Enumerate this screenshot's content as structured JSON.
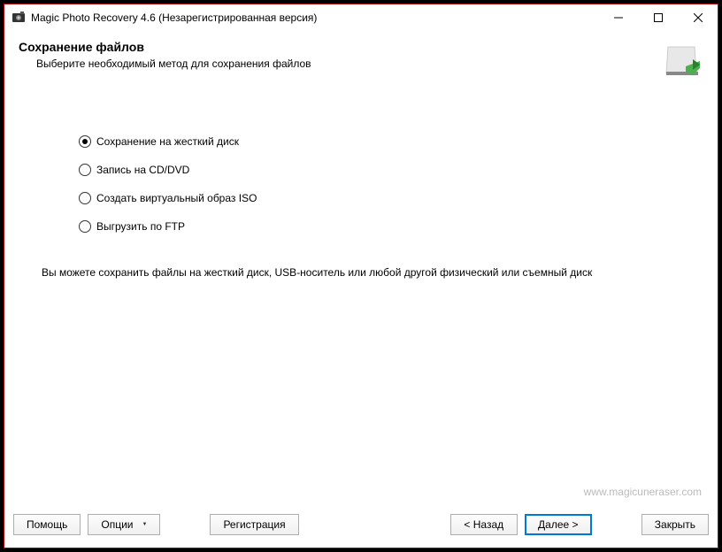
{
  "window": {
    "title": "Magic Photo Recovery 4.6 (Незарегистрированная версия)"
  },
  "header": {
    "title": "Сохранение файлов",
    "subtitle": "Выберите необходимый метод для сохранения файлов"
  },
  "options": [
    {
      "label": "Сохранение на жесткий диск",
      "selected": true
    },
    {
      "label": "Запись на CD/DVD",
      "selected": false
    },
    {
      "label": "Создать виртуальный образ ISO",
      "selected": false
    },
    {
      "label": "Выгрузить по FTP",
      "selected": false
    }
  ],
  "description": "Вы можете сохранить файлы на жесткий диск, USB-носитель или любой другой физический или съемный диск",
  "watermark": "www.magicuneraser.com",
  "buttons": {
    "help": "Помощь",
    "options": "Опции",
    "register": "Регистрация",
    "back": "< Назад",
    "next": "Далее >",
    "close": "Закрыть"
  }
}
